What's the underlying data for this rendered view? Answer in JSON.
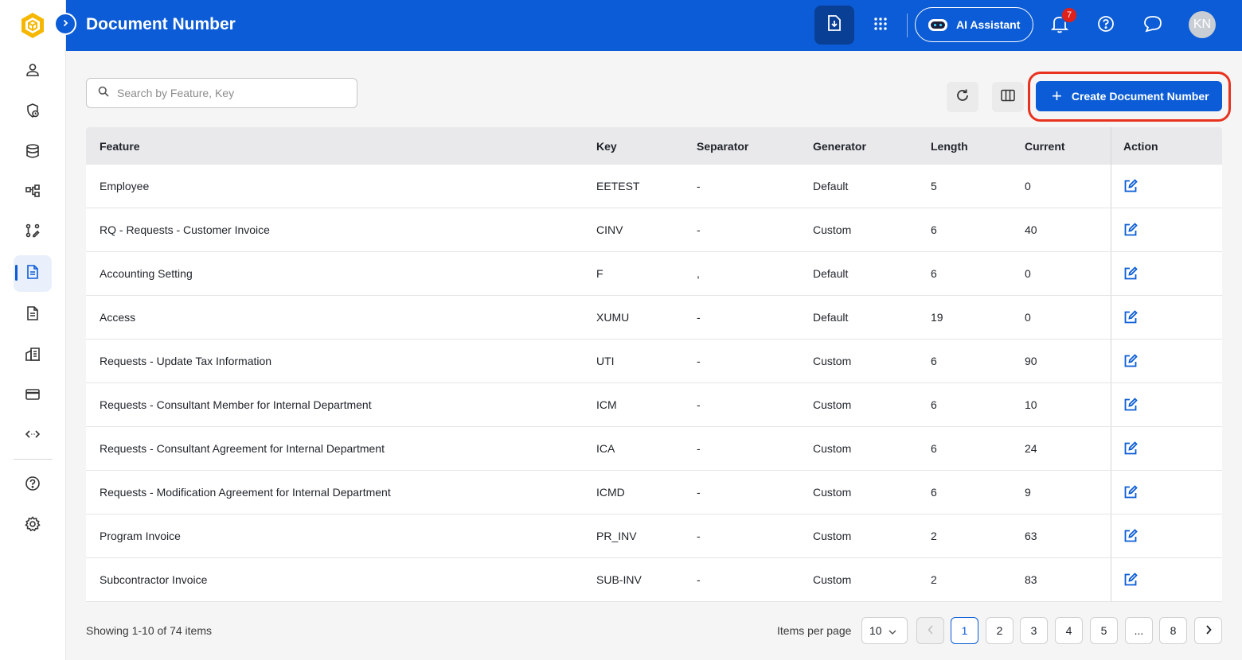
{
  "sidebar": {
    "logo": "hexagon-cube-logo",
    "expand": "chevron-right-icon",
    "items": [
      {
        "icon": "user-icon",
        "active": false
      },
      {
        "icon": "shield-clock-icon",
        "active": false
      },
      {
        "icon": "database-icon",
        "active": false
      },
      {
        "icon": "workflow-icon",
        "active": false
      },
      {
        "icon": "flow-edit-icon",
        "active": false
      },
      {
        "icon": "document-number-icon",
        "active": true
      },
      {
        "icon": "document-icon",
        "active": false
      },
      {
        "icon": "building-icon",
        "active": false
      },
      {
        "icon": "card-icon",
        "active": false
      },
      {
        "icon": "api-icon",
        "active": false
      },
      {
        "icon": "help-icon",
        "active": false
      },
      {
        "icon": "settings-icon",
        "active": false
      }
    ]
  },
  "header": {
    "title": "Document Number",
    "ai_assistant_label": "AI Assistant",
    "notification_count": "7",
    "avatar_initials": "KN",
    "accent_color": "#0b5cd6"
  },
  "toolbar": {
    "search_placeholder": "Search by Feature, Key",
    "create_label": "Create Document Number"
  },
  "table": {
    "columns": [
      "Feature",
      "Key",
      "Separator",
      "Generator",
      "Length",
      "Current",
      "Action"
    ],
    "rows": [
      {
        "feature": "Employee",
        "key": "EETEST",
        "separator": "-",
        "generator": "Default",
        "length": "5",
        "current": "0"
      },
      {
        "feature": "RQ - Requests - Customer Invoice",
        "key": "CINV",
        "separator": "-",
        "generator": "Custom",
        "length": "6",
        "current": "40"
      },
      {
        "feature": "Accounting Setting",
        "key": "F",
        "separator": ",",
        "generator": "Default",
        "length": "6",
        "current": "0"
      },
      {
        "feature": "Access",
        "key": "XUMU",
        "separator": "-",
        "generator": "Default",
        "length": "19",
        "current": "0"
      },
      {
        "feature": "Requests - Update Tax Information",
        "key": "UTI",
        "separator": "-",
        "generator": "Custom",
        "length": "6",
        "current": "90"
      },
      {
        "feature": "Requests - Consultant Member for Internal Department",
        "key": "ICM",
        "separator": "-",
        "generator": "Custom",
        "length": "6",
        "current": "10"
      },
      {
        "feature": "Requests - Consultant Agreement for Internal Department",
        "key": "ICA",
        "separator": "-",
        "generator": "Custom",
        "length": "6",
        "current": "24"
      },
      {
        "feature": "Requests - Modification Agreement for Internal Department",
        "key": "ICMD",
        "separator": "-",
        "generator": "Custom",
        "length": "6",
        "current": "9"
      },
      {
        "feature": "Program Invoice",
        "key": "PR_INV",
        "separator": "-",
        "generator": "Custom",
        "length": "2",
        "current": "63"
      },
      {
        "feature": "Subcontractor Invoice",
        "key": "SUB-INV",
        "separator": "-",
        "generator": "Custom",
        "length": "2",
        "current": "83"
      }
    ]
  },
  "footer": {
    "showing": "Showing 1-10 of 74 items",
    "items_per_page_label": "Items per page",
    "items_per_page_value": "10",
    "pages": [
      "1",
      "2",
      "3",
      "4",
      "5",
      "...",
      "8"
    ],
    "current_page": "1"
  }
}
